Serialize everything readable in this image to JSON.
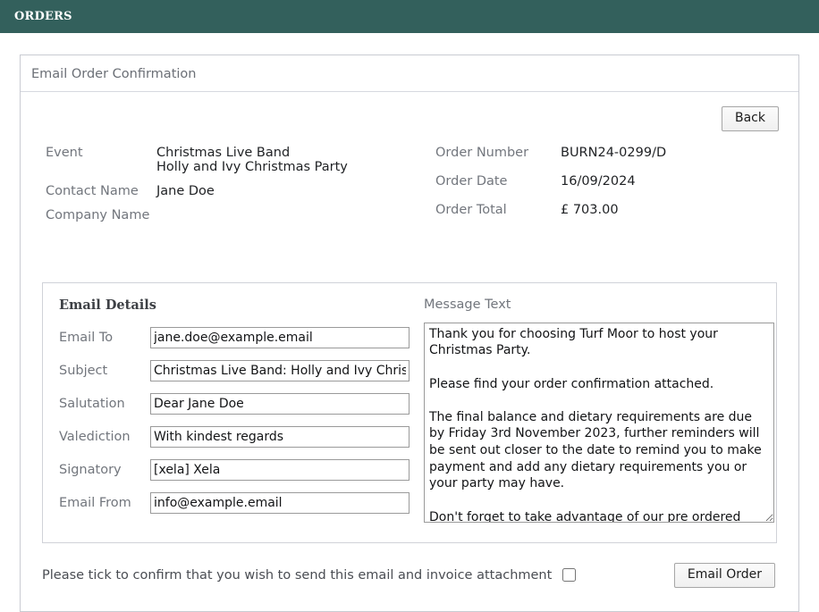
{
  "topbar": {
    "title": "ORDERS"
  },
  "panel": {
    "header_title": "Email Order Confirmation",
    "back_label": "Back"
  },
  "summary": {
    "left": [
      {
        "label": "Event",
        "value": "Christmas Live Band\nHolly and Ivy Christmas Party"
      },
      {
        "label": "Contact Name",
        "value": "Jane Doe"
      },
      {
        "label": "Company Name",
        "value": ""
      }
    ],
    "right": [
      {
        "label": "Order Number",
        "value": "BURN24-0299/D"
      },
      {
        "label": "Order Date",
        "value": "16/09/2024"
      },
      {
        "label": "Order Total",
        "value": "£ 703.00"
      }
    ]
  },
  "details": {
    "title": "Email Details",
    "fields": [
      {
        "label": "Email To",
        "value": "jane.doe@example.email",
        "placeholder": ""
      },
      {
        "label": "Subject",
        "value": "Christmas Live Band: Holly and Ivy Christmas Party",
        "placeholder": ""
      },
      {
        "label": "Salutation",
        "value": "Dear Jane Doe",
        "placeholder": ""
      },
      {
        "label": "Valediction",
        "value": "With kindest regards",
        "placeholder": ""
      },
      {
        "label": "Signatory",
        "value": "[xela] Xela",
        "placeholder": ""
      },
      {
        "label": "Email From",
        "value": "info@example.email",
        "placeholder": ""
      }
    ],
    "message_label": "Message Text",
    "message_value": "Thank you for choosing Turf Moor to host your Christmas Party.\n\nPlease find your order confirmation attached.\n\nThe final balance and dietary requirements are due by Friday 3rd November 2023, further reminders will be sent out closer to the date to remind you to make payment and add any dietary requirements you or your party may have.\n\nDon't forget to take advantage of our pre ordered drinks options."
  },
  "footer": {
    "confirm_text": "Please tick to confirm that you wish to send this email and invoice attachment",
    "confirm_checked": false,
    "email_order_label": "Email Order"
  },
  "colors": {
    "topbar_bg": "#33605c",
    "panel_border": "#c9cbd2",
    "label_text": "#72767d",
    "value_text": "#1f2124"
  }
}
